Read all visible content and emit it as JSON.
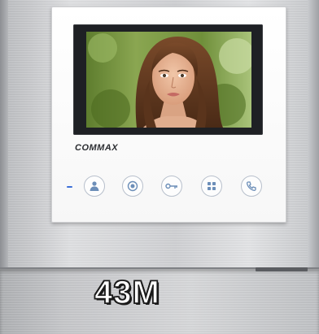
{
  "device": {
    "brand": "COMMAX",
    "model_label": "43M",
    "indicator_color": "#3c6fd8"
  },
  "screen": {
    "content": "camera-view"
  },
  "buttons": [
    {
      "name": "monitor-button",
      "icon": "person-icon"
    },
    {
      "name": "record-button",
      "icon": "record-icon"
    },
    {
      "name": "door-open-button",
      "icon": "key-icon"
    },
    {
      "name": "menu-button",
      "icon": "grid-icon"
    },
    {
      "name": "talk-button",
      "icon": "handset-icon"
    }
  ]
}
